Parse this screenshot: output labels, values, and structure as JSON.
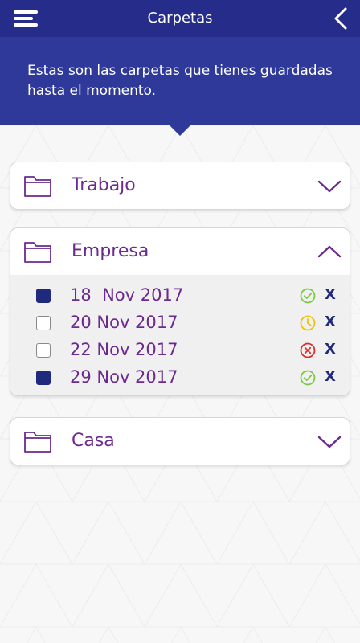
{
  "header": {
    "title": "Carpetas",
    "menu_icon": "hamburger-menu-icon",
    "back_icon": "chevron-left-icon",
    "color": "#262c8a"
  },
  "banner": {
    "text": "Estas son las carpetas que tienes guardadas hasta el momento.",
    "color": "#2f3999"
  },
  "folders": [
    {
      "name": "Trabajo",
      "icon": "folder-icon",
      "expanded": false,
      "toggle_icon": "chevron-down-icon"
    },
    {
      "name": "Empresa",
      "icon": "folder-icon",
      "expanded": true,
      "toggle_icon": "chevron-up-icon",
      "entries": [
        {
          "date": "18  Nov 2017",
          "checked": true,
          "status": "approved",
          "status_icon": "check-circle-icon",
          "status_color": "#7ac943",
          "remove_label": "X"
        },
        {
          "date": "20 Nov 2017",
          "checked": false,
          "status": "pending",
          "status_icon": "clock-icon",
          "status_color": "#f2c200",
          "remove_label": "X"
        },
        {
          "date": "22 Nov 2017",
          "checked": false,
          "status": "rejected",
          "status_icon": "x-circle-icon",
          "status_color": "#e02b2b",
          "remove_label": "X"
        },
        {
          "date": "29 Nov 2017",
          "checked": true,
          "status": "approved",
          "status_icon": "check-circle-icon",
          "status_color": "#7ac943",
          "remove_label": "X"
        }
      ]
    },
    {
      "name": "Casa",
      "icon": "folder-icon",
      "expanded": false,
      "toggle_icon": "chevron-down-icon"
    }
  ],
  "colors": {
    "accent_purple": "#6b2a8f",
    "checkbox_checked": "#1f2a7c"
  }
}
